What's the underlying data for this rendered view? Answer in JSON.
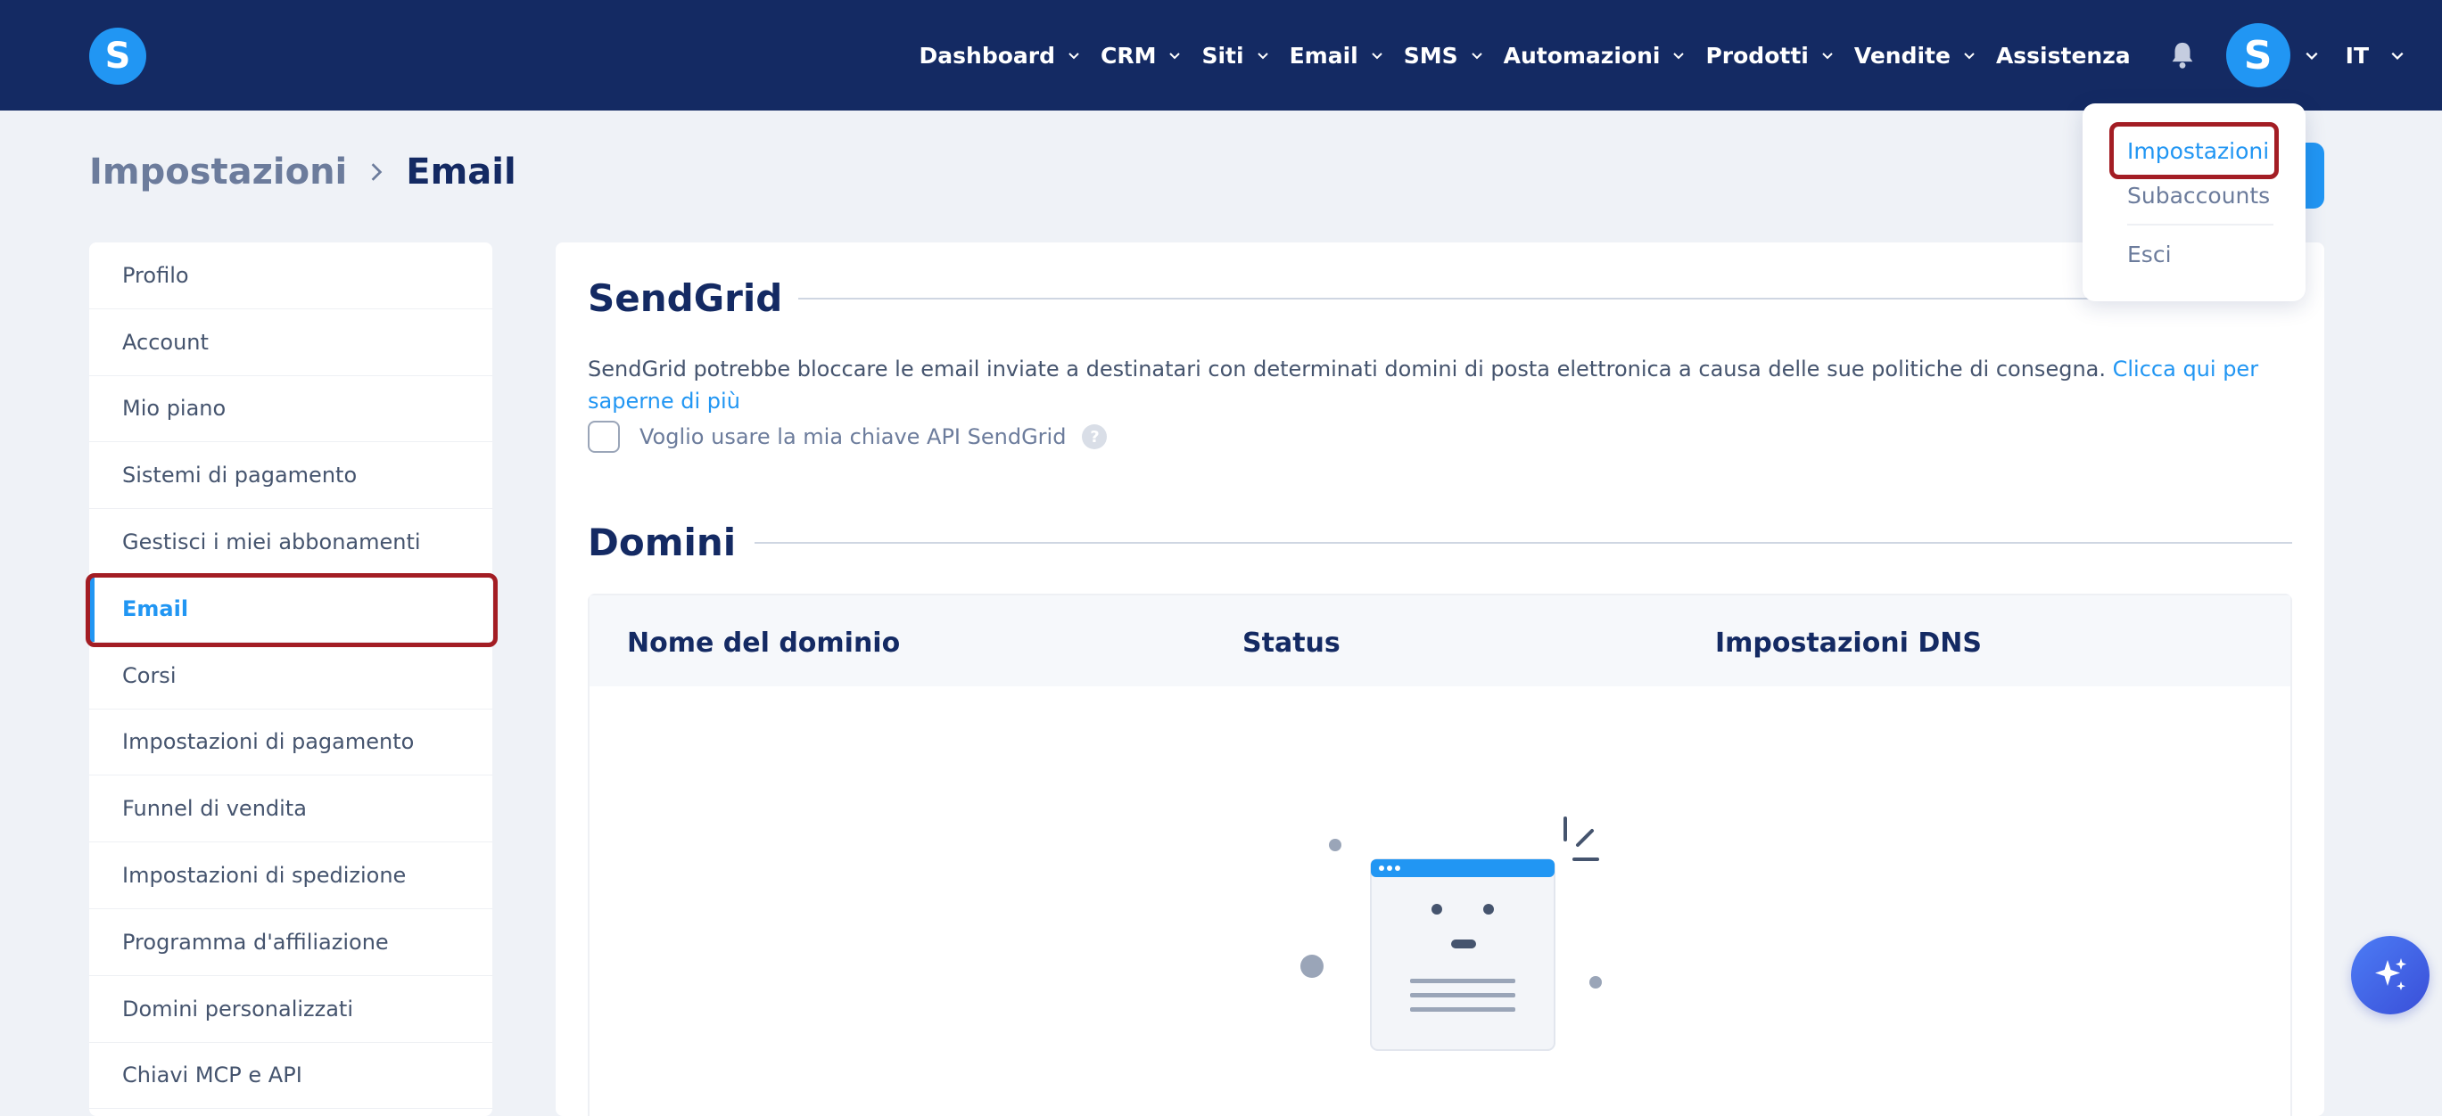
{
  "navbar": {
    "logo_letter": "S",
    "items": [
      {
        "label": "Dashboard",
        "dropdown": true
      },
      {
        "label": "CRM",
        "dropdown": true
      },
      {
        "label": "Siti",
        "dropdown": true
      },
      {
        "label": "Email",
        "dropdown": true
      },
      {
        "label": "SMS",
        "dropdown": true
      },
      {
        "label": "Automazioni",
        "dropdown": true
      },
      {
        "label": "Prodotti",
        "dropdown": true
      },
      {
        "label": "Vendite",
        "dropdown": true
      },
      {
        "label": "Assistenza",
        "dropdown": false
      }
    ],
    "avatar_letter": "S",
    "language": "IT"
  },
  "breadcrumb": {
    "parent": "Impostazioni",
    "current": "Email"
  },
  "sidebar": {
    "items": [
      {
        "label": "Profilo"
      },
      {
        "label": "Account"
      },
      {
        "label": "Mio piano"
      },
      {
        "label": "Sistemi di pagamento"
      },
      {
        "label": "Gestisci i miei abbonamenti"
      },
      {
        "label": "Email",
        "active": true
      },
      {
        "label": "Corsi"
      },
      {
        "label": "Impostazioni di pagamento"
      },
      {
        "label": "Funnel di vendita"
      },
      {
        "label": "Impostazioni di spedizione"
      },
      {
        "label": "Programma d'affiliazione"
      },
      {
        "label": "Domini personalizzati"
      },
      {
        "label": "Chiavi MCP e API"
      }
    ]
  },
  "sendgrid": {
    "title": "SendGrid",
    "description": "SendGrid potrebbe bloccare le email inviate a destinatari con determinati domini di posta elettronica a causa delle sue politiche di consegna.",
    "link_text": "Clicca qui per saperne di più",
    "checkbox_label": "Voglio usare la mia chiave API SendGrid",
    "help_symbol": "?"
  },
  "domains": {
    "title": "Domini",
    "columns": [
      "Nome del dominio",
      "Status",
      "Impostazioni DNS"
    ]
  },
  "user_menu": {
    "items": [
      "Impostazioni",
      "Subaccounts",
      "Esci"
    ]
  },
  "colors": {
    "navbar": "#142a63",
    "accent": "#2196f3",
    "highlight": "#a31d24"
  }
}
